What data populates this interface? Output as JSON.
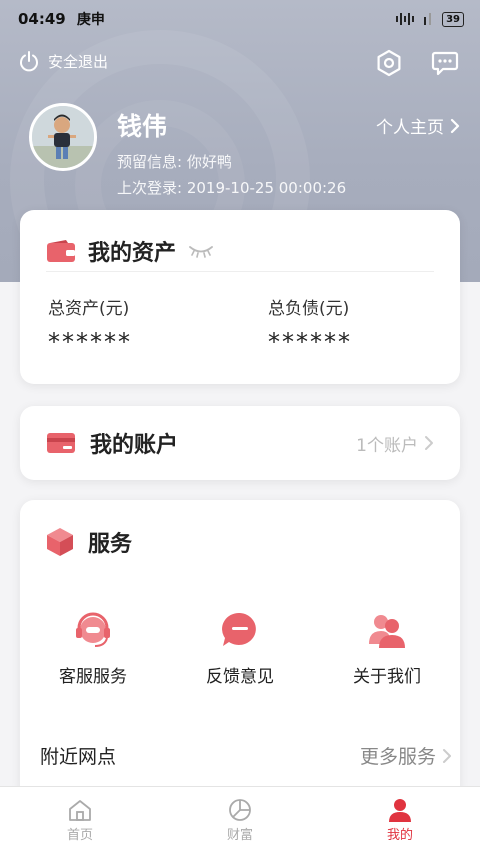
{
  "status_bar": {
    "time": "04:49",
    "day": "庚申",
    "battery": "39"
  },
  "header": {
    "logout_label": "安全退出",
    "settings_icon": "hexagon-settings-icon",
    "message_icon": "chat-bubble-icon"
  },
  "profile": {
    "name": "钱伟",
    "profile_link": "个人主页",
    "reserved_info": "预留信息: 你好鸭",
    "last_login": "上次登录: 2019-10-25 00:00:26"
  },
  "assets": {
    "title": "我的资产",
    "total_assets_label": "总资产(元)",
    "total_assets_value": "******",
    "total_liabilities_label": "总负债(元)",
    "total_liabilities_value": "******"
  },
  "account": {
    "title": "我的账户",
    "count": "1个账户"
  },
  "services": {
    "title": "服务",
    "items": [
      {
        "label": "客服服务",
        "icon": "headset-icon"
      },
      {
        "label": "反馈意见",
        "icon": "feedback-bubble-icon"
      },
      {
        "label": "关于我们",
        "icon": "people-icon"
      }
    ],
    "nearby": "附近网点",
    "more": "更多服务"
  },
  "bottom_nav": [
    {
      "label": "首页",
      "icon": "home-icon"
    },
    {
      "label": "财富",
      "icon": "pie-chart-icon"
    },
    {
      "label": "我的",
      "icon": "user-icon",
      "active": true
    }
  ],
  "colors": {
    "accent": "#e0333f",
    "icon_red": "#e8636b",
    "header_gray": "#a9afbf"
  }
}
